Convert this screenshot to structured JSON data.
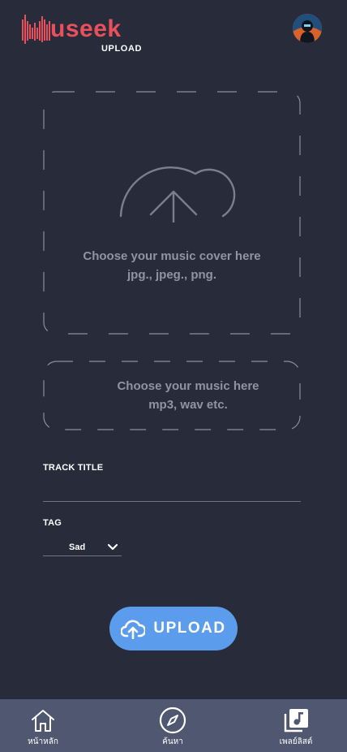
{
  "app": {
    "logo_text": "useek",
    "logo_mark": "M",
    "page_label": "UPLOAD",
    "brand_color": "#e8505b",
    "accent_color": "#5b9cec"
  },
  "header": {
    "avatar_icon": "user-avatar"
  },
  "cover_upload": {
    "icon": "cloud-upload-icon",
    "line1": "Choose your music cover here",
    "line2": "jpg., jpeg., png."
  },
  "music_upload": {
    "line1": "Choose your music here",
    "line2": "mp3, wav etc."
  },
  "form": {
    "track_title_label": "TRACK TITLE",
    "track_title_value": "",
    "tag_label": "TAG",
    "tag_value": "Sad"
  },
  "upload_button": {
    "label": "UPLOAD",
    "icon": "cloud-upload-icon"
  },
  "bottom_nav": {
    "items": [
      {
        "label": "หน้าหลัก",
        "icon": "home-icon"
      },
      {
        "label": "ค้นหา",
        "icon": "compass-icon"
      },
      {
        "label": "เพลย์ลิสต์",
        "icon": "music-library-icon"
      }
    ]
  }
}
